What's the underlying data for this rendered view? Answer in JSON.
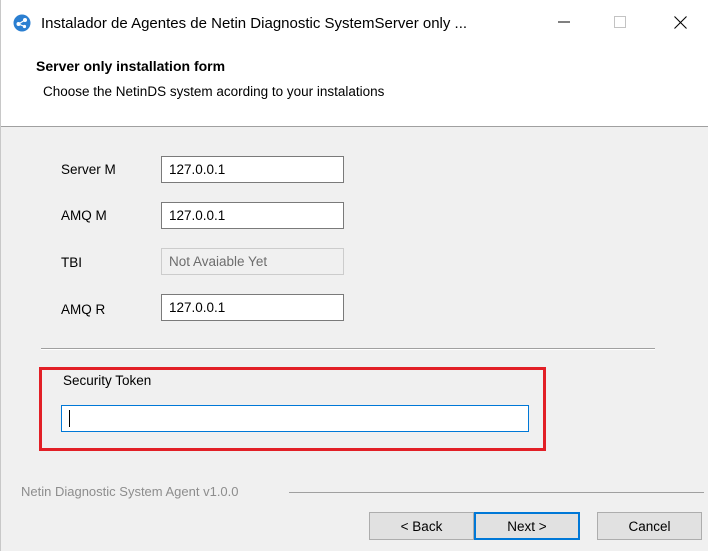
{
  "window": {
    "title": "Instalador de Agentes de Netin Diagnostic SystemServer only ...",
    "minimize_glyph": "—",
    "close_glyph": "✕"
  },
  "header": {
    "title": "Server only installation form",
    "subtitle": "Choose the NetinDS system acording to your instalations"
  },
  "form": {
    "fields": [
      {
        "label": "Server M",
        "value": "127.0.0.1",
        "disabled": false
      },
      {
        "label": "AMQ M",
        "value": "127.0.0.1",
        "disabled": false
      },
      {
        "label": "TBI",
        "value": "Not Avaiable Yet",
        "disabled": true
      },
      {
        "label": "AMQ R",
        "value": "127.0.0.1",
        "disabled": false
      }
    ],
    "security_token": {
      "label": "Security Token",
      "value": ""
    }
  },
  "footer": {
    "brand": "Netin Diagnostic System Agent v1.0.0",
    "back_label": "< Back",
    "next_label": "Next >",
    "cancel_label": "Cancel"
  },
  "colors": {
    "highlight": "#e21f26",
    "focus": "#0078d7",
    "app_icon": "#2b7fd1"
  },
  "icons": {
    "app": "netin-app-icon",
    "minimize": "minimize-icon",
    "maximize": "maximize-icon",
    "close": "close-icon"
  }
}
